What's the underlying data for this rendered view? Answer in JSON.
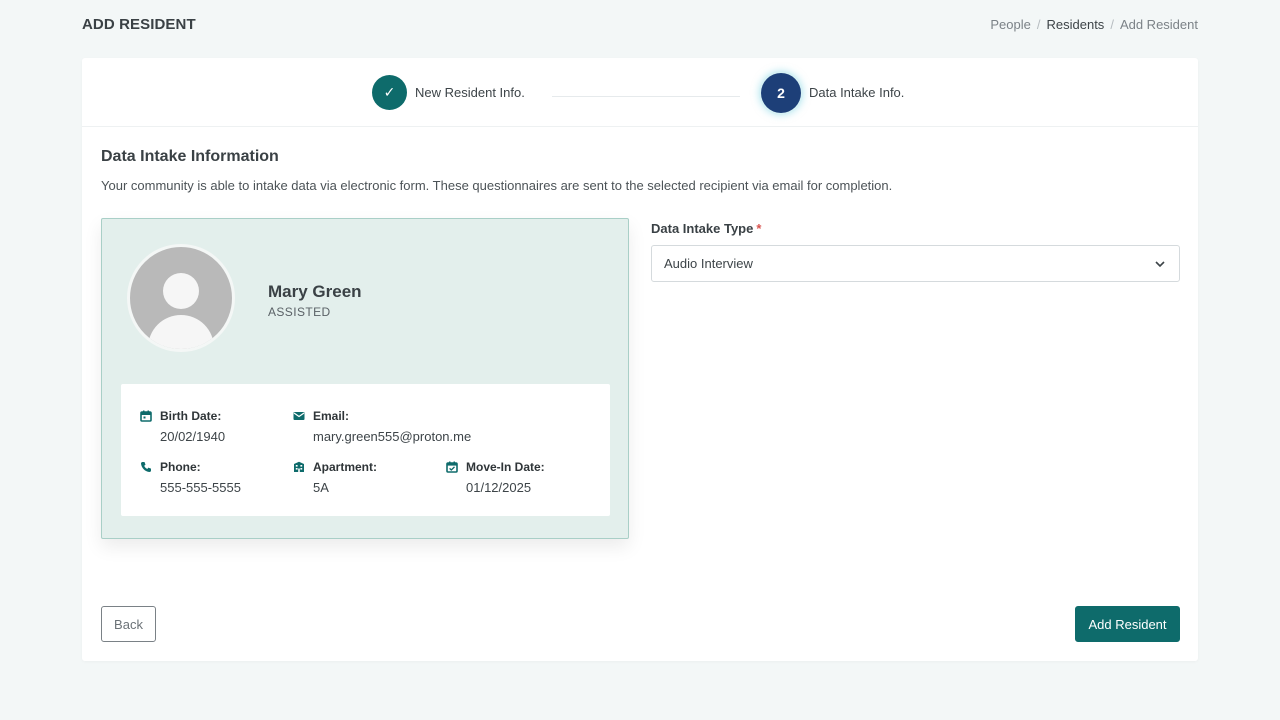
{
  "header": {
    "title": "ADD RESIDENT",
    "breadcrumb": [
      "People",
      "Residents",
      "Add Resident"
    ]
  },
  "stepper": {
    "steps": [
      {
        "marker": "✓",
        "label": "New Resident Info.",
        "state": "completed"
      },
      {
        "marker": "2",
        "label": "Data Intake Info.",
        "state": "current"
      }
    ]
  },
  "section": {
    "title": "Data Intake Information",
    "description": "Your community is able to intake data via electronic form. These questionnaires are sent to the selected recipient via email for completion."
  },
  "resident": {
    "name": "Mary Green",
    "care_level": "ASSISTED",
    "details": {
      "birth_date": {
        "label": "Birth Date:",
        "value": "20/02/1940",
        "icon": "calendar-icon"
      },
      "email": {
        "label": "Email:",
        "value": "mary.green555@proton.me",
        "icon": "envelope-icon"
      },
      "phone": {
        "label": "Phone:",
        "value": "555-555-5555",
        "icon": "phone-icon"
      },
      "apartment": {
        "label": "Apartment:",
        "value": "5A",
        "icon": "building-icon"
      },
      "move_in_date": {
        "label": "Move-In Date:",
        "value": "01/12/2025",
        "icon": "calendar-check-icon"
      }
    }
  },
  "form": {
    "intake_type": {
      "label": "Data Intake Type",
      "required_marker": "*",
      "value": "Audio Interview"
    }
  },
  "actions": {
    "back_label": "Back",
    "submit_label": "Add Resident"
  },
  "colors": {
    "primary": "#0e6b6b",
    "step_current": "#1d3f78",
    "resident_card_bg": "#e3efec",
    "required": "#d9534f"
  }
}
